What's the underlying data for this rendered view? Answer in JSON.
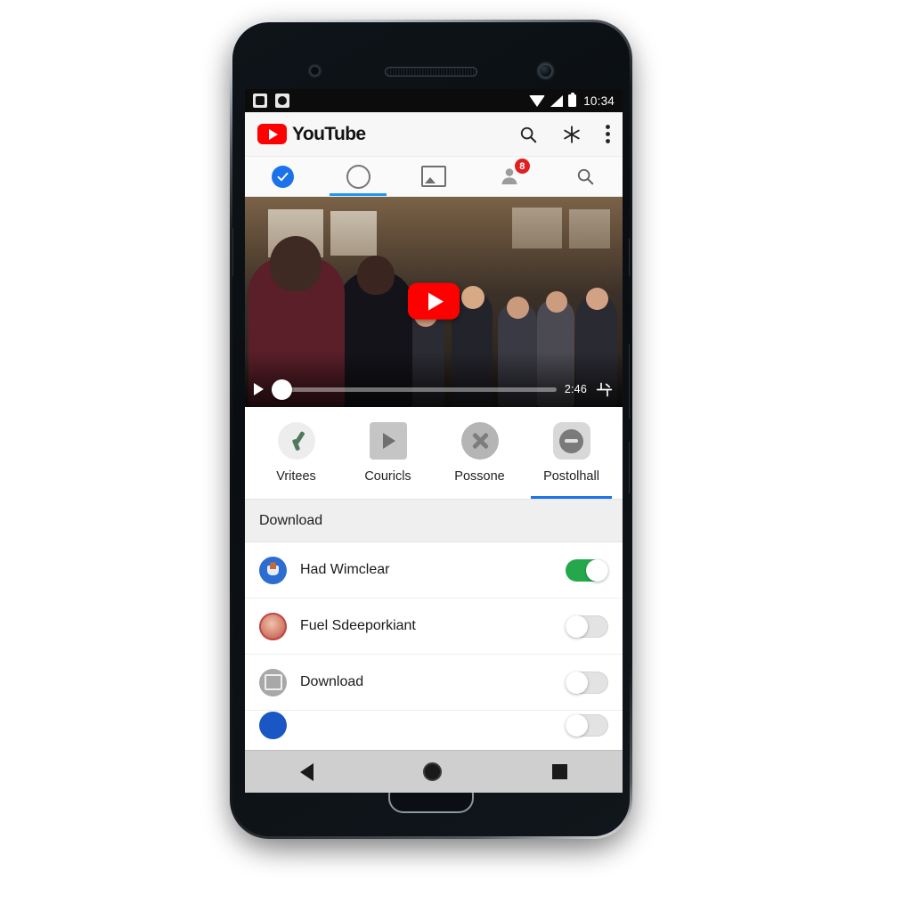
{
  "device": {
    "type": "android-smartphone",
    "hardware": {
      "sensor": "proximity-sensor",
      "earpiece": "earpiece-speaker",
      "camera": "front-camera",
      "home": "physical-home-button"
    }
  },
  "status_bar": {
    "time": "10:34",
    "notifications": [
      "notification-icon-1",
      "notification-icon-2"
    ],
    "indicators": [
      "wifi-icon",
      "signal-icon",
      "battery-icon"
    ]
  },
  "app_bar": {
    "brand": "YouTube",
    "logo_icon": "youtube-play-logo",
    "actions": [
      {
        "name": "search-icon",
        "label": "Search"
      },
      {
        "name": "cast-icon",
        "label": "Cast"
      },
      {
        "name": "overflow-menu-icon",
        "label": "More options"
      }
    ]
  },
  "tab_strip": {
    "active_index": 1,
    "tabs": [
      {
        "icon": "verified-check-icon",
        "name": "tab-home"
      },
      {
        "icon": "circle-outline-icon",
        "name": "tab-trending"
      },
      {
        "icon": "subscriptions-card-icon",
        "name": "tab-subscriptions"
      },
      {
        "icon": "account-icon",
        "name": "tab-notifications",
        "badge": "8"
      },
      {
        "icon": "search-icon",
        "name": "tab-search"
      }
    ]
  },
  "player": {
    "play_button": "play-overlay-button",
    "controls": {
      "play_icon": "play-icon",
      "time": "2:46",
      "settings_icon": "settings-icon",
      "progress_percent": 2
    }
  },
  "quick_tabs": {
    "active_index": 3,
    "items": [
      {
        "label": "Vritees",
        "icon": "check-mark-icon"
      },
      {
        "label": "Couricls",
        "icon": "play-square-icon"
      },
      {
        "label": "Possone",
        "icon": "close-x-icon"
      },
      {
        "label": "Postolhall",
        "icon": "minus-circle-icon"
      }
    ]
  },
  "section": {
    "header": "Download"
  },
  "settings_list": [
    {
      "label": "Had Wimclear",
      "avatar": "cup-avatar-icon",
      "toggle": "on"
    },
    {
      "label": "Fuel Sdeeporkiant",
      "avatar": "person-avatar-icon",
      "toggle": "off"
    },
    {
      "label": "Download",
      "avatar": "download-avatar-icon",
      "toggle": "off"
    },
    {
      "label": "",
      "avatar": "blue-avatar-icon",
      "toggle": "off"
    }
  ],
  "nav_bar": {
    "buttons": [
      {
        "name": "nav-back-button",
        "icon": "back-triangle-icon"
      },
      {
        "name": "nav-home-button",
        "icon": "home-circle-icon"
      },
      {
        "name": "nav-recents-button",
        "icon": "recents-square-icon"
      }
    ]
  },
  "colors": {
    "youtube_red": "#ff0000",
    "accent_blue": "#1a73e8",
    "toggle_on_green": "#25a84c",
    "badge_red": "#e02020",
    "status_bar": "#0c0c0c",
    "nav_bar": "#cfcfcf"
  }
}
